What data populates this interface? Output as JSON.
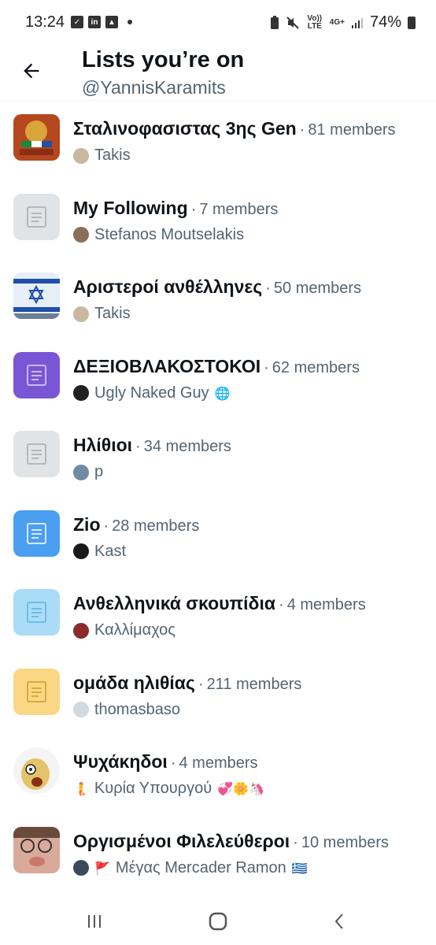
{
  "status_bar": {
    "time": "13:24",
    "network": "4G+",
    "volte": "Vo)) LTE",
    "battery": "74%"
  },
  "header": {
    "title": "Lists you’re on",
    "handle": "@YannisKaramits"
  },
  "lists": [
    {
      "name": "Σταλινοφασιστας 3ης Gen",
      "members": "81 members",
      "owner": "Takis",
      "owner_suffix": "",
      "avatar": "image-flags",
      "owner_avatar_color": "#c8b8a0"
    },
    {
      "name": "My Following",
      "members": "7 members",
      "owner": "Stefanos Moutselakis",
      "owner_suffix": "",
      "avatar": "list-icon-gray",
      "owner_avatar_color": "#8a6e5a"
    },
    {
      "name": "Αριστεροί ανθέλληνες",
      "members": "50 members",
      "owner": "Takis",
      "owner_suffix": "",
      "avatar": "image-israel-flag",
      "owner_avatar_color": "#c8b8a0"
    },
    {
      "name": "ΔΕΞΙΟΒΛΑΚΟΣΤΟΚΟΙ",
      "members": "62 members",
      "owner": "Ugly Naked Guy",
      "owner_suffix": "🌐",
      "avatar": "list-icon-purple",
      "owner_avatar_color": "#222222"
    },
    {
      "name": "Ηλίθιοι",
      "members": "34 members",
      "owner": "p",
      "owner_suffix": "",
      "avatar": "list-icon-gray",
      "owner_avatar_color": "#6f8aa3"
    },
    {
      "name": "Zio",
      "members": "28 members",
      "owner": "Kast",
      "owner_suffix": "",
      "avatar": "list-icon-blue",
      "owner_avatar_color": "#1a1a1a"
    },
    {
      "name": "Ανθελληνικά σκουπίδια",
      "members": "4 members",
      "owner": "Καλλίμαχος",
      "owner_suffix": "",
      "avatar": "list-icon-lightblue",
      "owner_avatar_color": "#8b2a2a"
    },
    {
      "name": "ομάδα ηλιθίας",
      "members": "211 members",
      "owner": "thomasbaso",
      "owner_suffix": "",
      "avatar": "list-icon-yellow",
      "owner_avatar_color": "#cfd9de"
    },
    {
      "name": "Ψυχάκηδοι",
      "members": "4 members",
      "owner": "Κυρία Υπουργού",
      "owner_prefix": "🧜",
      "owner_suffix": "💞🌼🦄",
      "avatar": "image-cartoon",
      "owner_avatar_color": ""
    },
    {
      "name": "Οργισμένοι Φιλελεύθεροι",
      "members": "10 members",
      "owner": "Μέγας Mercader Ramon",
      "owner_prefix": "🚩",
      "owner_suffix": "🇬🇷",
      "avatar": "image-face",
      "owner_avatar_color": "#3a4a5a"
    }
  ],
  "colors": {
    "gray_list": "#e1e4e6",
    "purple_list": "#7856d6",
    "blue_list": "#4a9ff0",
    "lightblue_list": "#aadcf8",
    "yellow_list": "#fbd785",
    "text_primary": "#0f1419",
    "text_secondary": "#536471"
  }
}
